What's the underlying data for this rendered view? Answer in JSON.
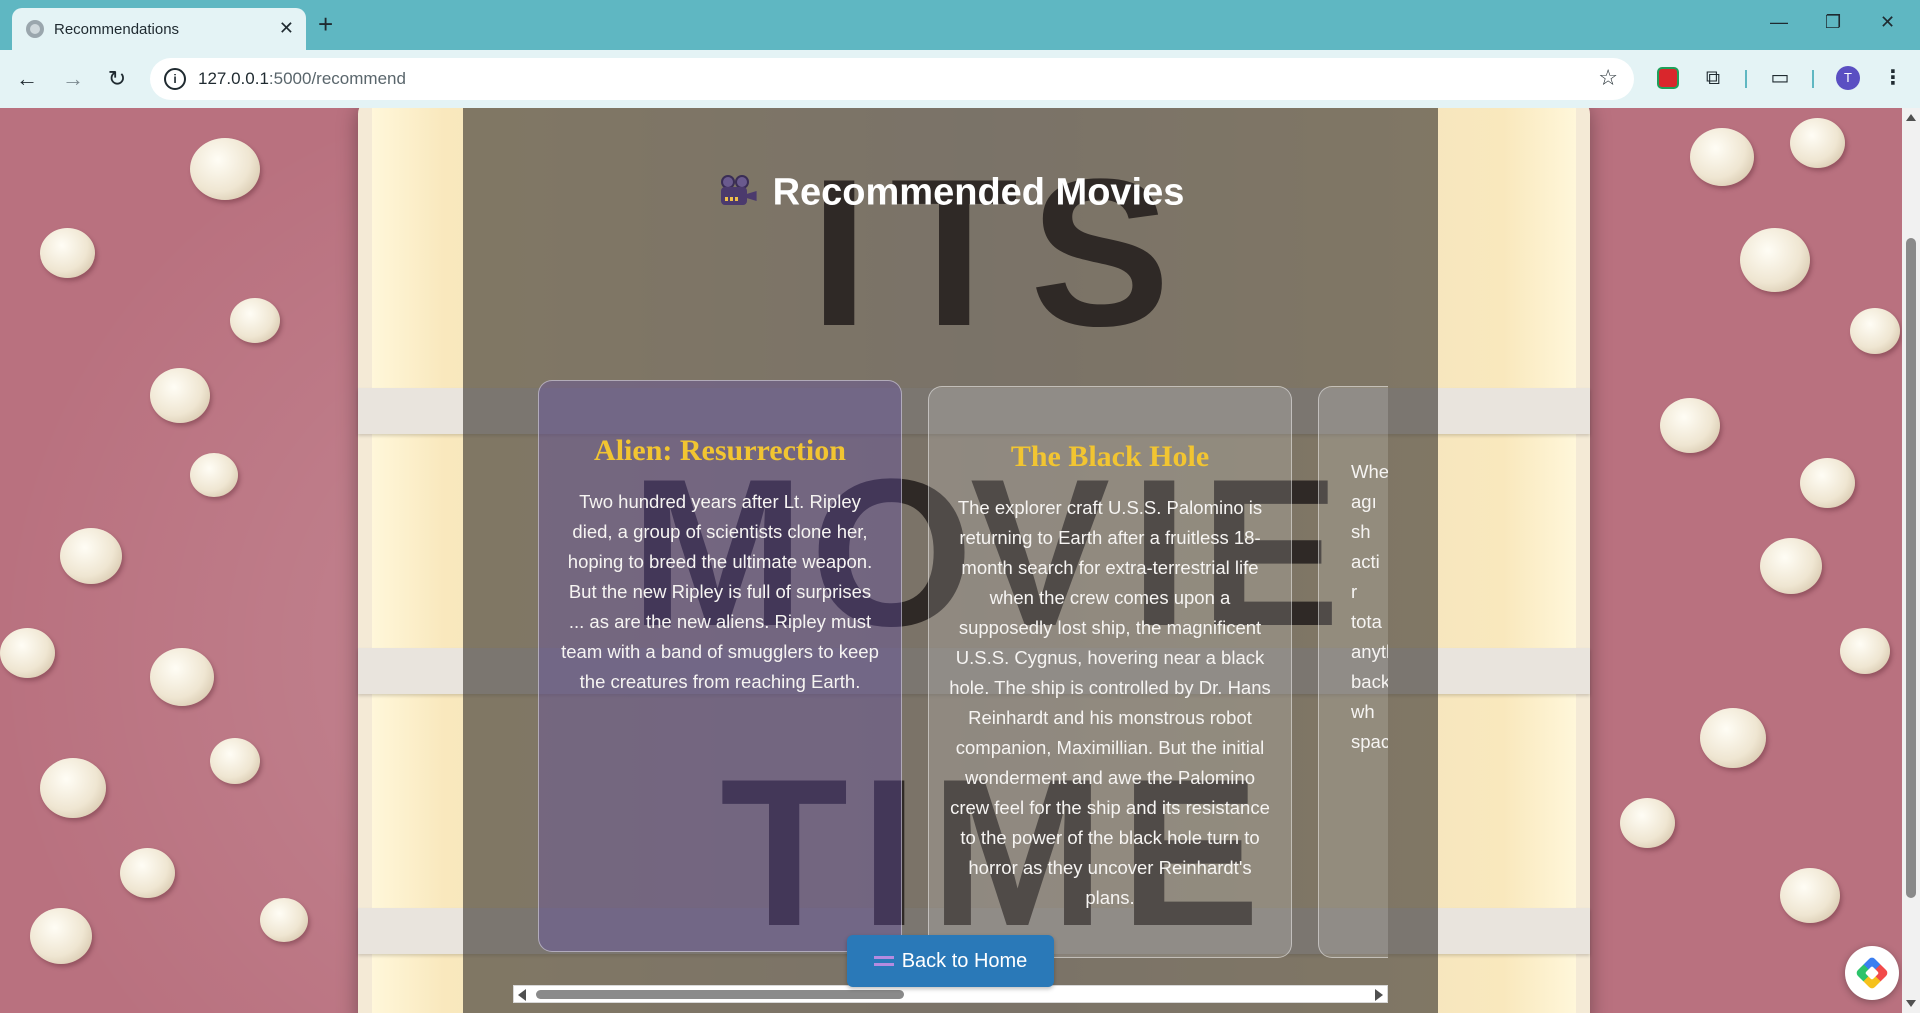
{
  "browser": {
    "tab_title": "Recommendations",
    "tab_close": "✕",
    "new_tab": "+",
    "window_minimize": "—",
    "window_restore": "❐",
    "window_close": "✕",
    "url_host": "127.0.0.1",
    "url_path": ":5000/recommend",
    "profile_initial": "T",
    "icons": {
      "back": "arrow-left-icon",
      "forward": "arrow-right-icon",
      "reload": "reload-icon",
      "site_info": "info-icon",
      "bookmark": "star-icon",
      "menu": "three-dots-icon"
    }
  },
  "page": {
    "heading": "Recommended Movies",
    "heading_icon": "movie-camera-icon",
    "movies": [
      {
        "title": "Alien: Resurrection",
        "description": "Two hundred years after Lt. Ripley died, a group of scientists clone her, hoping to breed the ultimate weapon. But the new Ripley is full of surprises ... as are the new aliens. Ripley must team with a band of smugglers to keep the creatures from reaching Earth."
      },
      {
        "title": "The Black Hole",
        "description": "The explorer craft U.S.S. Palomino is returning to Earth after a fruitless 18-month search for extra-terrestrial life when the crew comes upon a supposedly lost ship, the magnificent U.S.S. Cygnus, hovering near a black hole. The ship is controlled by Dr. Hans Reinhardt and his monstrous robot companion, Maximillian. But the initial wonderment and awe the Palomino crew feel for the ship and its resistance to the power of the black hole turn to horror as they uncover Reinhardt's plans."
      },
      {
        "title": "",
        "description": "Whe\nagı\nsh\nacti\nr\ntota\nanyth\nback\nwh\nspace"
      }
    ],
    "back_button": "Back to Home",
    "back_button_icon": "back-arrows-icon",
    "background_letters": [
      "I",
      "T",
      "S",
      "M",
      "O",
      "V",
      "I",
      "E",
      "T",
      "I",
      "M",
      "E"
    ]
  },
  "colors": {
    "browser_frame": "#5fb7c2",
    "card_title": "#f2c531",
    "button": "#2a79b8",
    "background_pink": "#b9717f"
  }
}
